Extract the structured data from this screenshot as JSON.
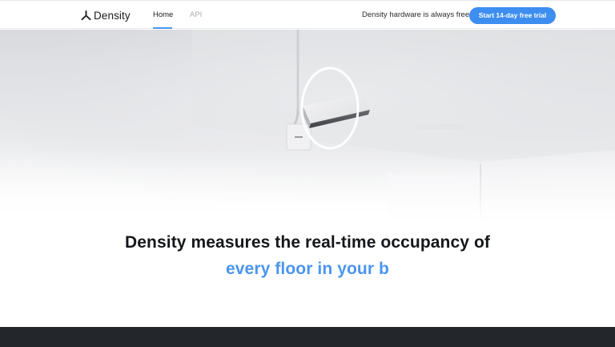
{
  "nav": {
    "brand": "Density",
    "brand_icon": "density-logo-icon",
    "links": [
      {
        "label": "Home",
        "active": true
      },
      {
        "label": "API",
        "active": false
      }
    ],
    "promo_text": "Density hardware is always free.",
    "cta_label": "Start 14-day free trial"
  },
  "hero": {
    "image": "density-sensor-ceiling-illustration"
  },
  "headline": {
    "line1": "Density measures the real-time occupancy of",
    "line2": "every floor in your b"
  },
  "colors": {
    "accent": "#4b95f0",
    "cta": "#3d8ef0",
    "dark_band": "#23272b",
    "text": "#15171b"
  }
}
